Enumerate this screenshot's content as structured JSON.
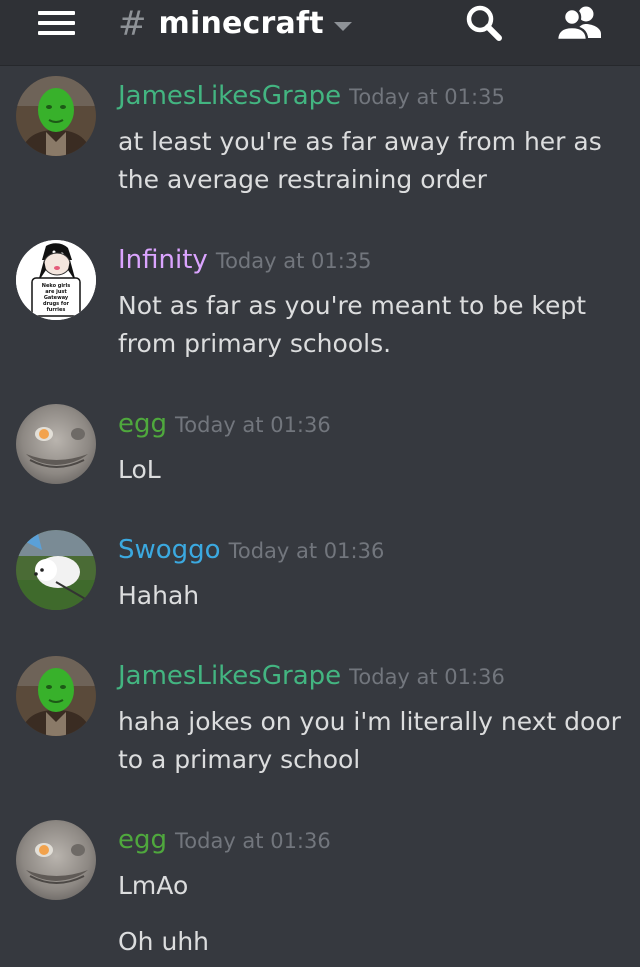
{
  "header": {
    "channel_name": "minecraft",
    "hash_symbol": "#"
  },
  "messages": [
    {
      "username": "JamesLikesGrape",
      "username_color": "#43b581",
      "timestamp": "Today at 01:35",
      "lines": [
        "at least you're as far away from her as",
        "the average restraining order"
      ],
      "avatar": "green-face-avatar"
    },
    {
      "username": "Infinity",
      "username_color": "#dba4ff",
      "timestamp": "Today at 01:35",
      "lines": [
        "Not as far as you're meant to be kept",
        "from primary schools."
      ],
      "avatar": "drawing-avatar",
      "avatar_text": [
        "Neko girls",
        "are just",
        "Gateway",
        "drugs for",
        "furries"
      ]
    },
    {
      "username": "egg",
      "username_color": "#4fa83d",
      "timestamp": "Today at 01:36",
      "lines": [
        "LoL"
      ],
      "avatar": "fish-avatar"
    },
    {
      "username": "Swoggo",
      "username_color": "#3ba9e0",
      "timestamp": "Today at 01:36",
      "lines": [
        "Hahah"
      ],
      "avatar": "dog-avatar"
    },
    {
      "username": "JamesLikesGrape",
      "username_color": "#43b581",
      "timestamp": "Today at 01:36",
      "lines": [
        "haha jokes on you i'm literally next door",
        "to a primary school"
      ],
      "avatar": "green-face-avatar"
    },
    {
      "username": "egg",
      "username_color": "#4fa83d",
      "timestamp": "Today at 01:36",
      "lines": [
        "LmAo",
        "",
        "Oh uhh"
      ],
      "avatar": "fish-avatar"
    }
  ],
  "colors": {
    "background": "#36393f",
    "topbar": "#2f3136",
    "message_text": "#dcddde",
    "timestamp": "#72767d"
  }
}
